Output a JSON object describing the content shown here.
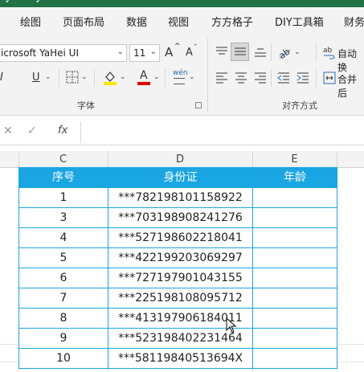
{
  "titlebar": {
    "glyphs": [
      "✓",
      "✓"
    ]
  },
  "menu": [
    "绘图",
    "页面布局",
    "数据",
    "视图",
    "方方格子",
    "DIY工具箱",
    "财务"
  ],
  "font": {
    "name": "icrosoft YaHei UI",
    "size": "11",
    "grow": "A",
    "shrink": "A"
  },
  "format_buttons": {
    "italic": "I",
    "underline": "U"
  },
  "group_labels": {
    "font": "字体",
    "alignment": "对齐方式"
  },
  "alignment": {
    "wrap_text": "自动换",
    "merge_center": "合并后",
    "phonetic": "wén"
  },
  "formula_bar": {
    "fx": "fx",
    "value": ""
  },
  "columns": [
    "C",
    "D",
    "E"
  ],
  "table": {
    "headers": [
      "序号",
      "身份证",
      "年龄"
    ],
    "rows": [
      [
        "1",
        "***782198101158922",
        ""
      ],
      [
        "3",
        "***703198908241276",
        ""
      ],
      [
        "4",
        "***527198602218041",
        ""
      ],
      [
        "5",
        "***422199203069297",
        ""
      ],
      [
        "6",
        "***727197901043155",
        ""
      ],
      [
        "7",
        "***225198108095712",
        ""
      ],
      [
        "8",
        "***413197906184011",
        ""
      ],
      [
        "9",
        "***523198402231464",
        ""
      ],
      [
        "10",
        "***58119840513694X",
        ""
      ]
    ]
  },
  "colors": {
    "header_fill": "#1aa6e2",
    "border": "#1aa6e2",
    "accent": "#217346"
  }
}
